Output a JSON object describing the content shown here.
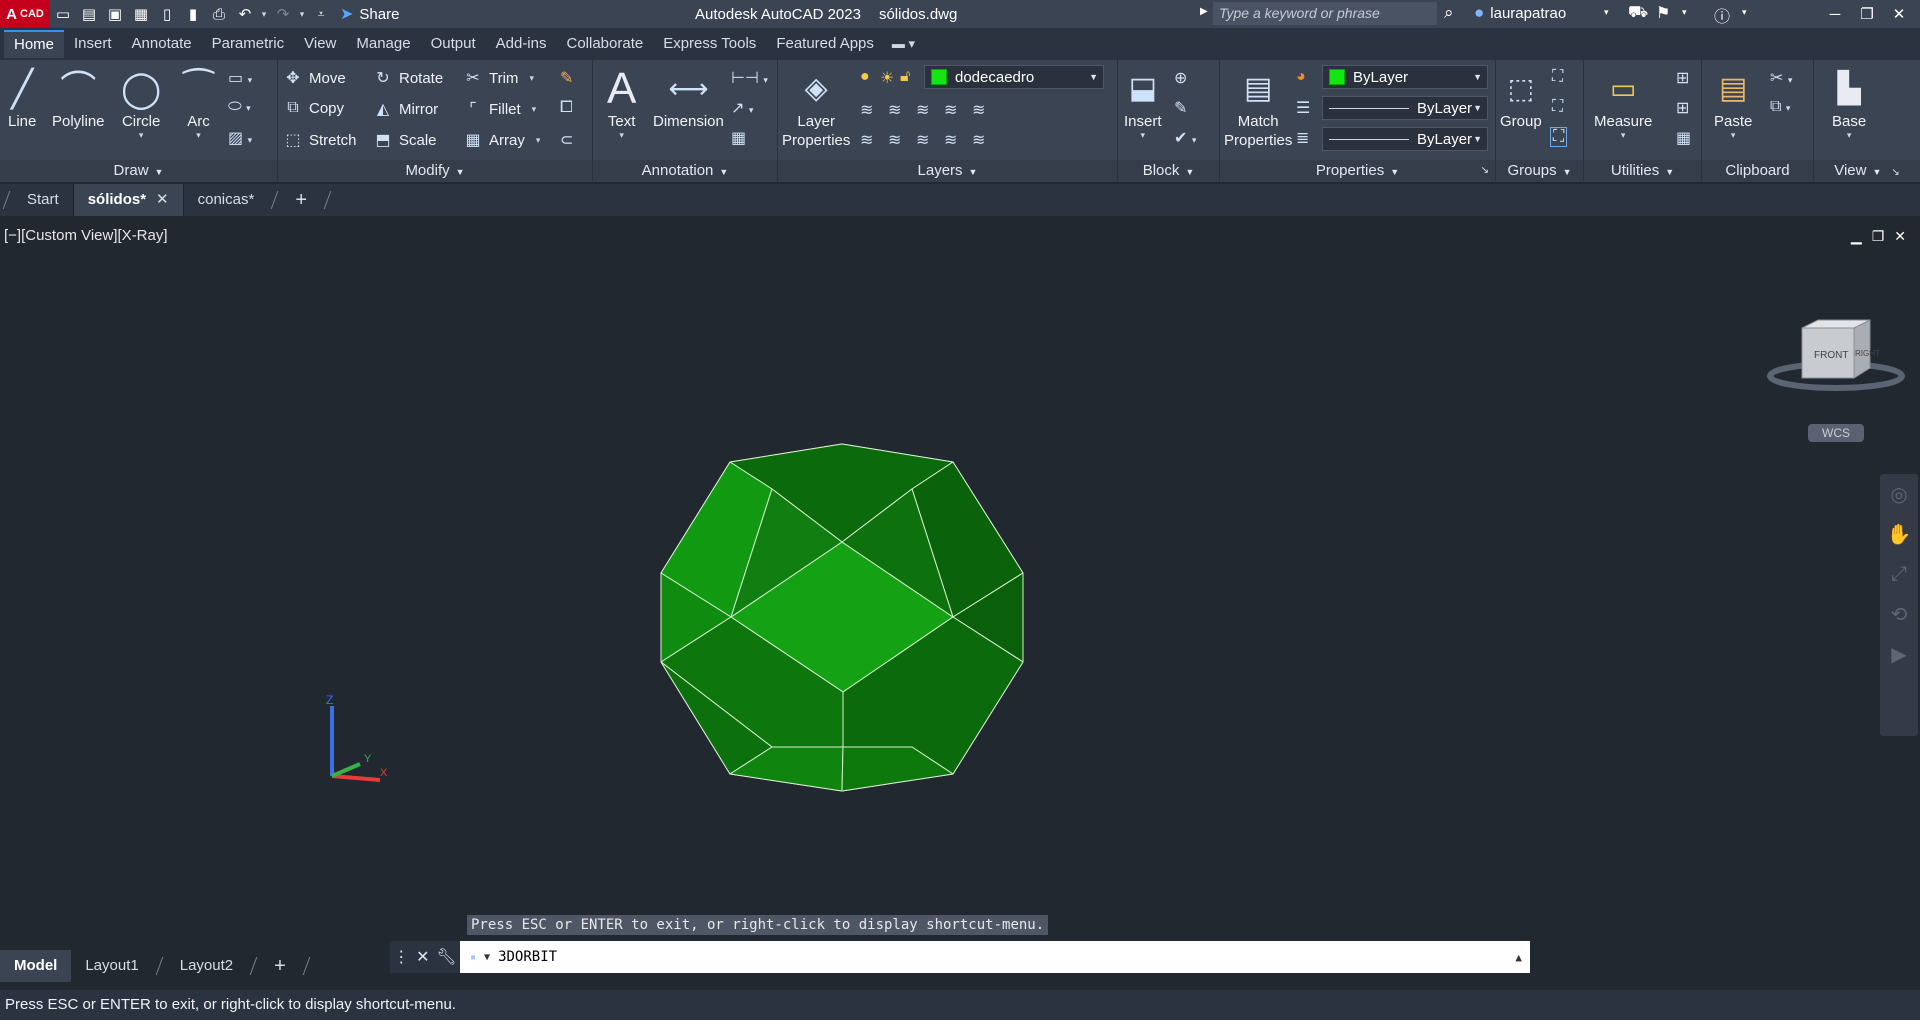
{
  "titlebar": {
    "logo_main": "A",
    "logo_sub": "CAD",
    "share_label": "Share",
    "app_title": "Autodesk AutoCAD 2023",
    "file_name": "sólidos.dwg",
    "search_placeholder": "Type a keyword or phrase",
    "username": "laurapatrao"
  },
  "ribbon_tabs": [
    "Home",
    "Insert",
    "Annotate",
    "Parametric",
    "View",
    "Manage",
    "Output",
    "Add-ins",
    "Collaborate",
    "Express Tools",
    "Featured Apps"
  ],
  "ribbon": {
    "draw": {
      "title": "Draw",
      "line": "Line",
      "polyline": "Polyline",
      "circle": "Circle",
      "arc": "Arc"
    },
    "modify": {
      "title": "Modify",
      "move": "Move",
      "rotate": "Rotate",
      "trim": "Trim",
      "copy": "Copy",
      "mirror": "Mirror",
      "fillet": "Fillet",
      "stretch": "Stretch",
      "scale": "Scale",
      "array": "Array"
    },
    "annotation": {
      "title": "Annotation",
      "text": "Text",
      "dimension": "Dimension"
    },
    "layers": {
      "title": "Layers",
      "layer_properties_1": "Layer",
      "layer_properties_2": "Properties",
      "current_layer": "dodecaedro"
    },
    "block": {
      "title": "Block",
      "insert": "Insert"
    },
    "properties": {
      "title": "Properties",
      "match_1": "Match",
      "match_2": "Properties",
      "color": "ByLayer",
      "linetype": "ByLayer",
      "lineweight": "ByLayer"
    },
    "groups": {
      "title": "Groups",
      "group": "Group"
    },
    "utilities": {
      "title": "Utilities",
      "measure": "Measure"
    },
    "clipboard": {
      "title": "Clipboard",
      "paste": "Paste"
    },
    "view": {
      "title": "View",
      "base": "Base"
    }
  },
  "file_tabs": [
    {
      "label": "Start"
    },
    {
      "label": "sólidos*"
    },
    {
      "label": "conicas*"
    }
  ],
  "viewport": {
    "label": "[−][Custom View][X-Ray]",
    "viewcube_front": "FRONT",
    "viewcube_right": "RIGHT",
    "wcs": "WCS",
    "ucs_x": "X",
    "ucs_y": "Y",
    "ucs_z": "Z"
  },
  "command": {
    "hint": "Press ESC or ENTER to exit, or right-click to display shortcut-menu.",
    "current": "3DORBIT"
  },
  "layout_tabs": [
    "Model",
    "Layout1",
    "Layout2"
  ],
  "status_text": "Press ESC or ENTER to exit, or right-click to display shortcut-menu.",
  "colors": {
    "accent": "#3b8fe6",
    "solid_green": "#0e7a0e",
    "layer_swatch": "#14e614",
    "logo_red": "#c4001d"
  }
}
